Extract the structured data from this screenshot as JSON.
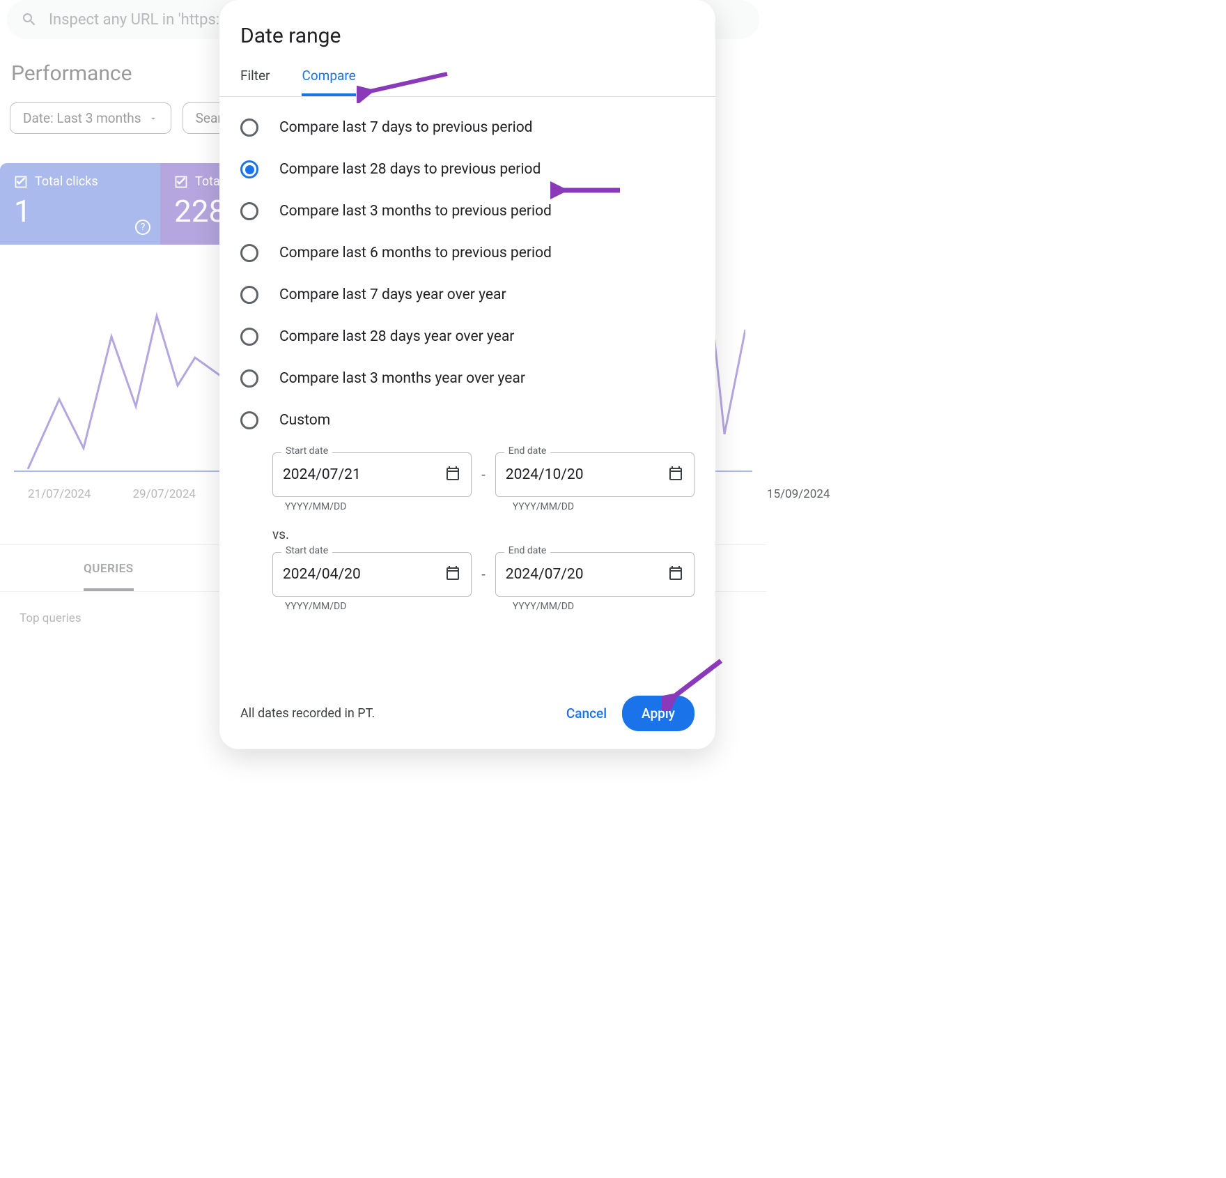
{
  "search": {
    "placeholder": "Inspect any URL in 'https://"
  },
  "page_title": "Performance",
  "chips": {
    "date": "Date: Last 3 months",
    "search": "Search"
  },
  "cards": {
    "clicks": {
      "label": "Total clicks",
      "value": "1"
    },
    "impr": {
      "label": "Tota",
      "value": "228"
    }
  },
  "xaxis": [
    "21/07/2024",
    "29/07/2024",
    "15/09/2024"
  ],
  "tab_bg": "QUERIES",
  "top_queries": "Top queries",
  "modal": {
    "title": "Date range",
    "tabs": {
      "filter": "Filter",
      "compare": "Compare"
    },
    "options": [
      "Compare last 7 days to previous period",
      "Compare last 28 days to previous period",
      "Compare last 3 months to previous period",
      "Compare last 6 months to previous period",
      "Compare last 7 days year over year",
      "Compare last 28 days year over year",
      "Compare last 3 months year over year",
      "Custom"
    ],
    "selected_index": 1,
    "fields": {
      "start_label": "Start date",
      "end_label": "End date",
      "format_hint": "YYYY/MM/DD",
      "range1": {
        "start": "2024/07/21",
        "end": "2024/10/20"
      },
      "vs": "vs.",
      "range2": {
        "start": "2024/04/20",
        "end": "2024/07/20"
      }
    },
    "footnote": "All dates recorded in PT.",
    "cancel": "Cancel",
    "apply": "Apply"
  }
}
